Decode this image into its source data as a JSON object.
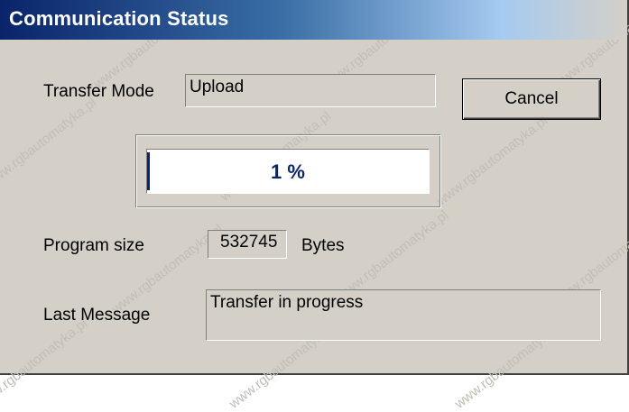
{
  "window": {
    "title": "Communication Status"
  },
  "transfer_mode": {
    "label": "Transfer Mode",
    "value": "Upload"
  },
  "buttons": {
    "cancel": "Cancel"
  },
  "progress": {
    "percent": 1,
    "text": "1 %"
  },
  "program_size": {
    "label": "Program size",
    "value": "532745",
    "unit": "Bytes"
  },
  "last_message": {
    "label": "Last Message",
    "value": "Transfer in progress"
  },
  "watermark_text": "www.rgbautomatyka.pl",
  "colors": {
    "title_start": "#0a246a",
    "progress": "#0a246a",
    "dialog_bg": "#d4d0c8"
  }
}
